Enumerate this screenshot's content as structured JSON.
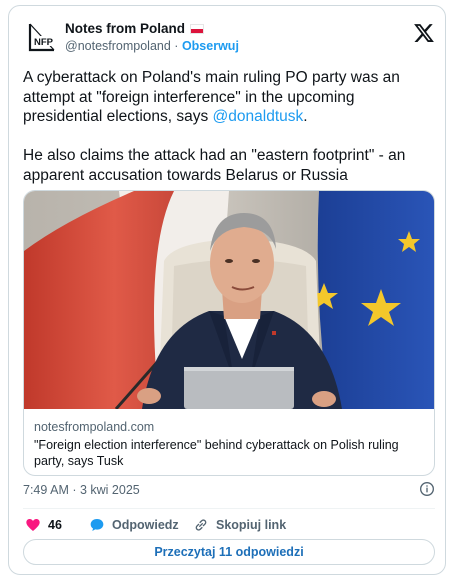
{
  "author": {
    "logo_text": "NFP",
    "name": "Notes from Poland",
    "handle": "@notesfrompoland",
    "separator": "·",
    "follow_label": "Obserwuj"
  },
  "tweet": {
    "paragraph1_text": "A cyberattack on Poland's main ruling PO party was an attempt at \"foreign interference\" in the upcoming presidential elections, says ",
    "mention": "@donaldtusk",
    "paragraph1_end": ".",
    "paragraph2": "He also claims the attack had an \"eastern footprint\" - an apparent accusation towards Belarus or Russia"
  },
  "link_card": {
    "domain": "notesfrompoland.com",
    "headline": "\"Foreign election interference\" behind cyberattack on Polish ruling party, says Tusk"
  },
  "timestamp": "7:49 AM · 3 kwi 2025",
  "actions": {
    "like_count": "46",
    "reply_label": "Odpowiedz",
    "copy_label": "Skopiuj link"
  },
  "read_replies_label": "Przeczytaj 11 odpowiedzi",
  "colors": {
    "accent": "#1d9bf0",
    "like": "#f91880",
    "text": "#0f1419",
    "muted": "#536471",
    "border": "#cfd9de"
  },
  "icons": [
    "x-logo-icon",
    "info-icon",
    "heart-icon",
    "reply-bubble-icon",
    "link-icon",
    "poland-flag-icon",
    "nfp-logo"
  ]
}
